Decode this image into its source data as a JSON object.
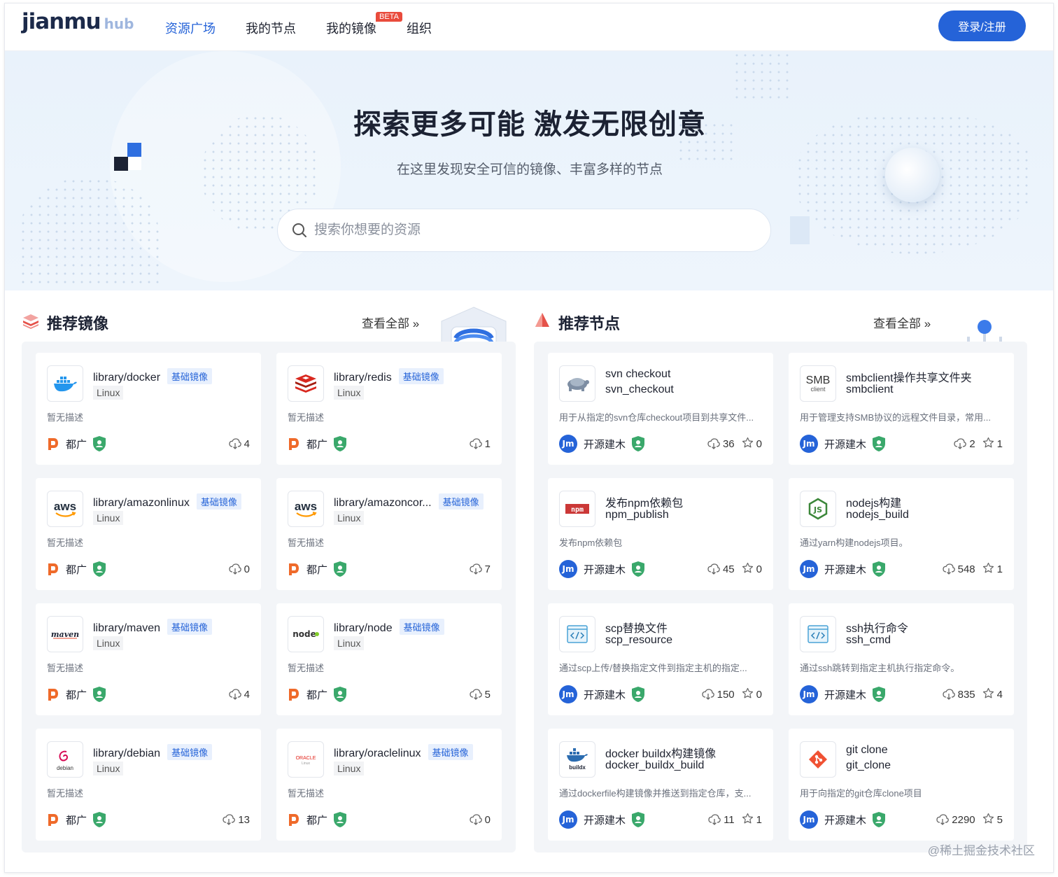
{
  "header": {
    "logo_main": "jianmu",
    "logo_sub": "hub",
    "nav": [
      "资源广场",
      "我的节点",
      "我的镜像",
      "组织"
    ],
    "beta": "BETA",
    "login": "登录/注册"
  },
  "hero": {
    "title": "探索更多可能 激发无限创意",
    "subtitle": "在这里发现安全可信的镜像、丰富多样的节点",
    "search_placeholder": "搜索你想要的资源"
  },
  "images_section": {
    "title": "推荐镜像",
    "view_all": "查看全部 »",
    "cards": [
      {
        "name": "library/docker",
        "tag": "基础镜像",
        "os": "Linux",
        "desc": "暂无描述",
        "owner": "都广",
        "downloads": "4",
        "icon": "docker-icon"
      },
      {
        "name": "library/redis",
        "tag": "基础镜像",
        "os": "Linux",
        "desc": "暂无描述",
        "owner": "都广",
        "downloads": "1",
        "icon": "redis-icon"
      },
      {
        "name": "library/amazonlinux",
        "tag": "基础镜像",
        "os": "Linux",
        "desc": "暂无描述",
        "owner": "都广",
        "downloads": "0",
        "icon": "aws-icon"
      },
      {
        "name": "library/amazoncor...",
        "tag": "基础镜像",
        "os": "Linux",
        "desc": "暂无描述",
        "owner": "都广",
        "downloads": "7",
        "icon": "aws-icon"
      },
      {
        "name": "library/maven",
        "tag": "基础镜像",
        "os": "Linux",
        "desc": "暂无描述",
        "owner": "都广",
        "downloads": "4",
        "icon": "maven-icon"
      },
      {
        "name": "library/node",
        "tag": "基础镜像",
        "os": "Linux",
        "desc": "暂无描述",
        "owner": "都广",
        "downloads": "5",
        "icon": "node-icon"
      },
      {
        "name": "library/debian",
        "tag": "基础镜像",
        "os": "Linux",
        "desc": "暂无描述",
        "owner": "都广",
        "downloads": "13",
        "icon": "debian-icon"
      },
      {
        "name": "library/oraclelinux",
        "tag": "基础镜像",
        "os": "Linux",
        "desc": "暂无描述",
        "owner": "都广",
        "downloads": "0",
        "icon": "oracle-icon"
      }
    ]
  },
  "nodes_section": {
    "title": "推荐节点",
    "view_all": "查看全部 »",
    "cards": [
      {
        "name": "svn checkout",
        "id": "svn_checkout",
        "desc": "用于从指定的svn仓库checkout项目到共享文件...",
        "owner": "开源建木",
        "downloads": "36",
        "stars": "0",
        "icon": "svn-icon"
      },
      {
        "name": "smbclient操作共享文件夹",
        "id": "smbclient",
        "desc": "用于管理支持SMB协议的远程文件目录，常用...",
        "owner": "开源建木",
        "downloads": "2",
        "stars": "1",
        "icon": "smb-icon"
      },
      {
        "name": "发布npm依赖包",
        "id": "npm_publish",
        "desc": "发布npm依赖包",
        "owner": "开源建木",
        "downloads": "45",
        "stars": "0",
        "icon": "npm-icon"
      },
      {
        "name": "nodejs构建",
        "id": "nodejs_build",
        "desc": "通过yarn构建nodejs项目。",
        "owner": "开源建木",
        "downloads": "548",
        "stars": "1",
        "icon": "nodejs-icon"
      },
      {
        "name": "scp替换文件",
        "id": "scp_resource",
        "desc": "通过scp上传/替换指定文件到指定主机的指定...",
        "owner": "开源建木",
        "downloads": "150",
        "stars": "0",
        "icon": "code-icon"
      },
      {
        "name": "ssh执行命令",
        "id": "ssh_cmd",
        "desc": "通过ssh跳转到指定主机执行指定命令。",
        "owner": "开源建木",
        "downloads": "835",
        "stars": "4",
        "icon": "code-icon"
      },
      {
        "name": "docker buildx构建镜像",
        "id": "docker_buildx_build",
        "desc": "通过dockerfile构建镜像并推送到指定仓库，支...",
        "owner": "开源建木",
        "downloads": "11",
        "stars": "1",
        "icon": "buildx-icon"
      },
      {
        "name": "git clone",
        "id": "git_clone",
        "desc": "用于向指定的git仓库clone项目",
        "owner": "开源建木",
        "downloads": "2290",
        "stars": "5",
        "icon": "git-icon"
      }
    ]
  },
  "smb_icon_text": {
    "big": "SMB",
    "small": "client"
  },
  "jm_avatar": "Jm",
  "watermark": "@稀土掘金技术社区",
  "colors": {
    "accent": "#2563d8",
    "owner_orange": "#ef6a2a",
    "shield_green": "#3aa86b"
  }
}
